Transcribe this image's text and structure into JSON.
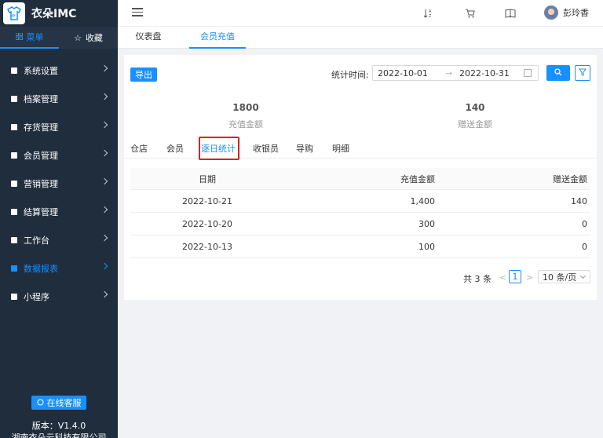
{
  "brand": {
    "name": "衣朵IMC"
  },
  "side_tabs": [
    {
      "label": "菜单",
      "icon": "grid-icon"
    },
    {
      "label": "收藏",
      "icon": "star-icon"
    }
  ],
  "menu": [
    {
      "label": "系统设置"
    },
    {
      "label": "档案管理"
    },
    {
      "label": "存货管理"
    },
    {
      "label": "会员管理"
    },
    {
      "label": "营销管理"
    },
    {
      "label": "结算管理"
    },
    {
      "label": "工作台"
    },
    {
      "label": "数据报表"
    },
    {
      "label": "小程序"
    }
  ],
  "sidebar_footer": {
    "service_label": "在线客服",
    "version": "版本：V1.4.0",
    "company": "湖南衣朵云科技有限公司"
  },
  "header": {
    "user_name": "彭玲香"
  },
  "top_tabs": [
    {
      "label": "仪表盘"
    },
    {
      "label": "会员充值"
    }
  ],
  "toolbar": {
    "export_label": "导出",
    "range_label": "统计时间:",
    "start_date": "2022-10-01",
    "arrow": "→",
    "end_date": "2022-10-31"
  },
  "stats": [
    {
      "value": "1800",
      "label": "充值金额"
    },
    {
      "value": "140",
      "label": "赠送金额"
    }
  ],
  "sub_tabs": [
    {
      "label": "仓店"
    },
    {
      "label": "会员"
    },
    {
      "label": "逐日统计"
    },
    {
      "label": "收银员"
    },
    {
      "label": "导购"
    },
    {
      "label": "明细"
    }
  ],
  "table": {
    "headers": [
      "日期",
      "充值金额",
      "赠送金额"
    ],
    "rows": [
      [
        "2022-10-21",
        "1,400",
        "140"
      ],
      [
        "2022-10-20",
        "300",
        "0"
      ],
      [
        "2022-10-13",
        "100",
        "0"
      ]
    ]
  },
  "pager": {
    "total": "共 3 条",
    "prev": "<",
    "page": "1",
    "next": ">",
    "page_size": "10 条/页"
  },
  "colors": {
    "accent": "#1890ff",
    "sidebar_bg": "#1f2d3d",
    "highlight": "#e02020"
  }
}
